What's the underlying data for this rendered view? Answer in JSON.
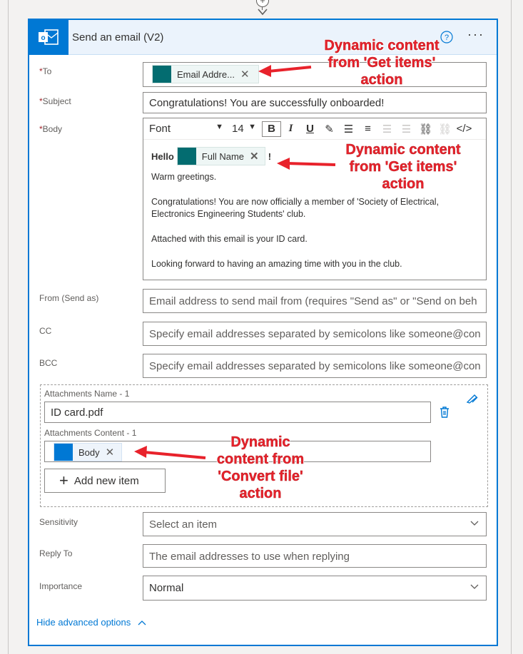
{
  "action": {
    "title": "Send an email (V2)"
  },
  "fields": {
    "to": {
      "label": "To",
      "token": "Email Addre..."
    },
    "subject": {
      "label": "Subject",
      "value": "Congratulations! You are successfully onboarded!"
    },
    "body": {
      "label": "Body",
      "toolbar": {
        "font": "Font",
        "size": "14"
      },
      "greeting": "Hello",
      "token": "Full Name",
      "exclaim": "!",
      "lines": [
        "Warm greetings.",
        "Congratulations! You are now officially a member of 'Society of Electrical, Electronics Engineering Students' club.",
        "Attached with this email is your ID card.",
        "Looking forward to having an amazing time with you in the club."
      ]
    },
    "from": {
      "label": "From (Send as)",
      "placeholder": "Email address to send mail from (requires \"Send as\" or \"Send on beh"
    },
    "cc": {
      "label": "CC",
      "placeholder": "Specify email addresses separated by semicolons like someone@con"
    },
    "bcc": {
      "label": "BCC",
      "placeholder": "Specify email addresses separated by semicolons like someone@con"
    },
    "attachments": {
      "name_label": "Attachments Name - 1",
      "name_value": "ID card.pdf",
      "content_label": "Attachments Content - 1",
      "content_token": "Body",
      "add_label": "Add new item"
    },
    "sensitivity": {
      "label": "Sensitivity",
      "value": "Select an item"
    },
    "reply_to": {
      "label": "Reply To",
      "placeholder": "The email addresses to use when replying"
    },
    "importance": {
      "label": "Importance",
      "value": "Normal"
    }
  },
  "advanced_link": "Hide advanced options",
  "callouts": {
    "to": [
      "Dynamic content",
      "from 'Get items'",
      "action"
    ],
    "body": [
      "Dynamic content",
      "from 'Get items'",
      "action"
    ],
    "attachment": [
      "Dynamic",
      "content from",
      "'Convert file'",
      "action"
    ]
  },
  "colors": {
    "accent": "#0078d4",
    "token_icon": "#036c70",
    "callout": "#e8222b"
  }
}
